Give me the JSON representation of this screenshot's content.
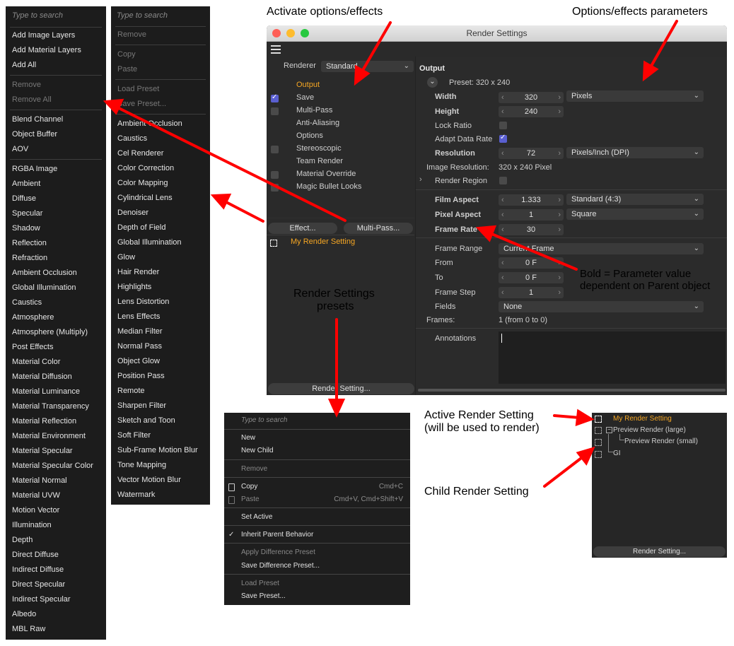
{
  "annotations": {
    "activate": "Activate options/effects",
    "parameters": "Options/effects parameters",
    "bold_line1": "Bold = Parameter value",
    "bold_line2": "dependent on Parent object",
    "presets_line1": "Render Settings",
    "presets_line2": "presets",
    "active_line1": "Active Render Setting",
    "active_line2": "(will be used to render)",
    "child": "Child Render Setting"
  },
  "menu1": {
    "search": "Type to search",
    "items": [
      {
        "label": "Add Image Layers"
      },
      {
        "label": "Add Material Layers"
      },
      {
        "label": "Add All"
      },
      {
        "label": "Remove"
      },
      {
        "label": "Remove All"
      },
      {
        "label": "Blend Channel"
      },
      {
        "label": "Object Buffer"
      },
      {
        "label": "AOV"
      },
      {
        "label": "RGBA Image"
      },
      {
        "label": "Ambient"
      },
      {
        "label": "Diffuse"
      },
      {
        "label": "Specular"
      },
      {
        "label": "Shadow"
      },
      {
        "label": "Reflection"
      },
      {
        "label": "Refraction"
      },
      {
        "label": "Ambient Occlusion"
      },
      {
        "label": "Global Illumination"
      },
      {
        "label": "Caustics"
      },
      {
        "label": "Atmosphere"
      },
      {
        "label": "Atmosphere (Multiply)"
      },
      {
        "label": "Post Effects"
      },
      {
        "label": "Material Color"
      },
      {
        "label": "Material Diffusion"
      },
      {
        "label": "Material Luminance"
      },
      {
        "label": "Material Transparency"
      },
      {
        "label": "Material Reflection"
      },
      {
        "label": "Material Environment"
      },
      {
        "label": "Material Specular"
      },
      {
        "label": "Material Specular Color"
      },
      {
        "label": "Material Normal"
      },
      {
        "label": "Material UVW"
      },
      {
        "label": "Motion Vector"
      },
      {
        "label": "Illumination"
      },
      {
        "label": "Depth"
      },
      {
        "label": "Direct Diffuse"
      },
      {
        "label": "Indirect Diffuse"
      },
      {
        "label": "Direct Specular"
      },
      {
        "label": "Indirect Specular"
      },
      {
        "label": "Albedo"
      },
      {
        "label": "MBL Raw"
      }
    ]
  },
  "menu2": {
    "search": "Type to search",
    "items": [
      {
        "label": "Remove"
      },
      {
        "label": "Copy"
      },
      {
        "label": "Paste"
      },
      {
        "label": "Load Preset"
      },
      {
        "label": "Save Preset..."
      },
      {
        "label": "Ambient Occlusion"
      },
      {
        "label": "Caustics"
      },
      {
        "label": "Cel Renderer"
      },
      {
        "label": "Color Correction"
      },
      {
        "label": "Color Mapping"
      },
      {
        "label": "Cylindrical Lens"
      },
      {
        "label": "Denoiser"
      },
      {
        "label": "Depth of Field"
      },
      {
        "label": "Global Illumination"
      },
      {
        "label": "Glow"
      },
      {
        "label": "Hair Render"
      },
      {
        "label": "Highlights"
      },
      {
        "label": "Lens Distortion"
      },
      {
        "label": "Lens Effects"
      },
      {
        "label": "Median Filter"
      },
      {
        "label": "Normal Pass"
      },
      {
        "label": "Object Glow"
      },
      {
        "label": "Position Pass"
      },
      {
        "label": "Remote"
      },
      {
        "label": "Sharpen Filter"
      },
      {
        "label": "Sketch and Toon"
      },
      {
        "label": "Soft Filter"
      },
      {
        "label": "Sub-Frame Motion Blur"
      },
      {
        "label": "Tone Mapping"
      },
      {
        "label": "Vector Motion Blur"
      },
      {
        "label": "Watermark"
      }
    ]
  },
  "window": {
    "title": "Render Settings",
    "colors": {
      "close": "#fe5f57",
      "minimize": "#febc2e",
      "zoom": "#28c840",
      "accent": "#f5a623",
      "check": "#5a5fd0"
    },
    "renderer_label": "Renderer",
    "renderer_value": "Standard",
    "left_items": [
      {
        "label": "Output",
        "checked": null
      },
      {
        "label": "Save",
        "checked": true
      },
      {
        "label": "Multi-Pass",
        "checked": false
      },
      {
        "label": "Anti-Aliasing",
        "checked": null
      },
      {
        "label": "Options",
        "checked": null
      },
      {
        "label": "Stereoscopic",
        "checked": false
      },
      {
        "label": "Team Render",
        "checked": null
      },
      {
        "label": "Material Override",
        "checked": false
      },
      {
        "label": "Magic Bullet Looks",
        "checked": false
      }
    ],
    "effect_button": "Effect...",
    "multipass_button": "Multi-Pass...",
    "my_render_setting": "My Render Setting",
    "render_setting_button": "Render Setting...",
    "section": "Output",
    "preset": "Preset: 320 x 240",
    "width_label": "Width",
    "width_value": "320",
    "width_unit": "Pixels",
    "height_label": "Height",
    "height_value": "240",
    "lock_ratio": "Lock Ratio",
    "lock_ratio_checked": false,
    "adapt_data_rate": "Adapt Data Rate",
    "adapt_data_rate_checked": true,
    "resolution_label": "Resolution",
    "resolution_value": "72",
    "resolution_unit": "Pixels/Inch (DPI)",
    "image_resolution_label": "Image Resolution:",
    "image_resolution_value": "320 x 240 Pixel",
    "render_region": "Render Region",
    "render_region_checked": false,
    "film_aspect_label": "Film Aspect",
    "film_aspect_value": "1.333",
    "film_aspect_preset": "Standard (4:3)",
    "pixel_aspect_label": "Pixel Aspect",
    "pixel_aspect_value": "1",
    "pixel_aspect_preset": "Square",
    "frame_rate_label": "Frame Rate",
    "frame_rate_value": "30",
    "frame_range_label": "Frame Range",
    "frame_range_value": "Current Frame",
    "from_label": "From",
    "from_value": "0 F",
    "to_label": "To",
    "to_value": "0 F",
    "frame_step_label": "Frame Step",
    "frame_step_value": "1",
    "fields_label": "Fields",
    "fields_value": "None",
    "frames_label": "Frames:",
    "frames_value": "1 (from 0 to 0)",
    "annotations_label": "Annotations"
  },
  "presets_menu": {
    "search": "Type to search",
    "items": [
      {
        "label": "New",
        "shortcut": "",
        "icon": "",
        "disabled": false
      },
      {
        "label": "New Child",
        "shortcut": "",
        "icon": "",
        "disabled": false
      },
      {
        "label": "Remove",
        "shortcut": "",
        "icon": "",
        "disabled": true
      },
      {
        "label": "Copy",
        "shortcut": "Cmd+C",
        "icon": "copy",
        "disabled": false
      },
      {
        "label": "Paste",
        "shortcut": "Cmd+V, Cmd+Shift+V",
        "icon": "paste",
        "disabled": true
      },
      {
        "label": "Set Active",
        "shortcut": "",
        "icon": "",
        "disabled": false
      },
      {
        "label": "Inherit Parent Behavior",
        "shortcut": "",
        "icon": "check",
        "disabled": false
      },
      {
        "label": "Apply Difference Preset",
        "shortcut": "",
        "icon": "",
        "disabled": true
      },
      {
        "label": "Save Difference Preset...",
        "shortcut": "",
        "icon": "",
        "disabled": false
      },
      {
        "label": "Load Preset",
        "shortcut": "",
        "icon": "",
        "disabled": true
      },
      {
        "label": "Save Preset...",
        "shortcut": "",
        "icon": "",
        "disabled": false
      }
    ]
  },
  "hierarchy": {
    "nodes": [
      {
        "label": "My Render Setting"
      },
      {
        "label": "Preview Render (large)"
      },
      {
        "label": "Preview Render (small)"
      },
      {
        "label": "GI"
      }
    ],
    "button": "Render Setting..."
  }
}
